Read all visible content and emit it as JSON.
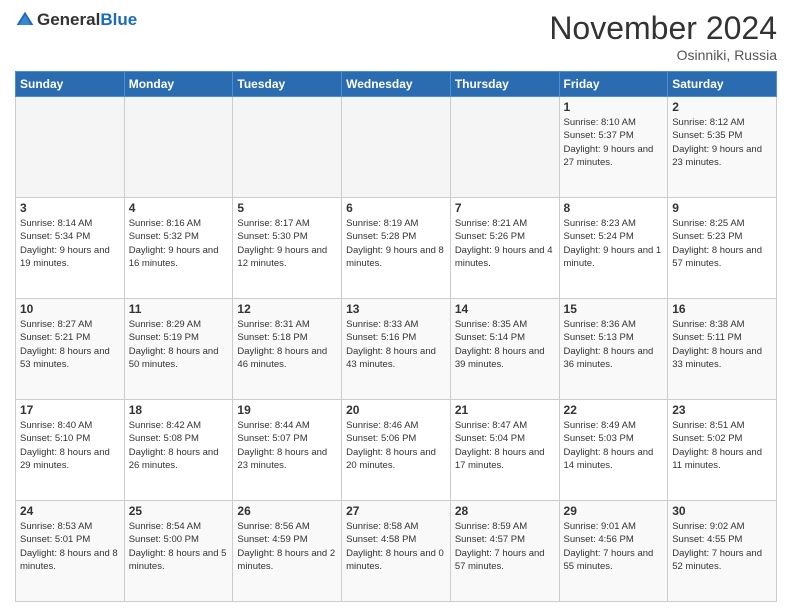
{
  "header": {
    "logo_line1": "General",
    "logo_line2": "Blue",
    "month_title": "November 2024",
    "location": "Osinniki, Russia"
  },
  "weekdays": [
    "Sunday",
    "Monday",
    "Tuesday",
    "Wednesday",
    "Thursday",
    "Friday",
    "Saturday"
  ],
  "weeks": [
    [
      {
        "day": "",
        "info": ""
      },
      {
        "day": "",
        "info": ""
      },
      {
        "day": "",
        "info": ""
      },
      {
        "day": "",
        "info": ""
      },
      {
        "day": "",
        "info": ""
      },
      {
        "day": "1",
        "info": "Sunrise: 8:10 AM\nSunset: 5:37 PM\nDaylight: 9 hours and 27 minutes."
      },
      {
        "day": "2",
        "info": "Sunrise: 8:12 AM\nSunset: 5:35 PM\nDaylight: 9 hours and 23 minutes."
      }
    ],
    [
      {
        "day": "3",
        "info": "Sunrise: 8:14 AM\nSunset: 5:34 PM\nDaylight: 9 hours and 19 minutes."
      },
      {
        "day": "4",
        "info": "Sunrise: 8:16 AM\nSunset: 5:32 PM\nDaylight: 9 hours and 16 minutes."
      },
      {
        "day": "5",
        "info": "Sunrise: 8:17 AM\nSunset: 5:30 PM\nDaylight: 9 hours and 12 minutes."
      },
      {
        "day": "6",
        "info": "Sunrise: 8:19 AM\nSunset: 5:28 PM\nDaylight: 9 hours and 8 minutes."
      },
      {
        "day": "7",
        "info": "Sunrise: 8:21 AM\nSunset: 5:26 PM\nDaylight: 9 hours and 4 minutes."
      },
      {
        "day": "8",
        "info": "Sunrise: 8:23 AM\nSunset: 5:24 PM\nDaylight: 9 hours and 1 minute."
      },
      {
        "day": "9",
        "info": "Sunrise: 8:25 AM\nSunset: 5:23 PM\nDaylight: 8 hours and 57 minutes."
      }
    ],
    [
      {
        "day": "10",
        "info": "Sunrise: 8:27 AM\nSunset: 5:21 PM\nDaylight: 8 hours and 53 minutes."
      },
      {
        "day": "11",
        "info": "Sunrise: 8:29 AM\nSunset: 5:19 PM\nDaylight: 8 hours and 50 minutes."
      },
      {
        "day": "12",
        "info": "Sunrise: 8:31 AM\nSunset: 5:18 PM\nDaylight: 8 hours and 46 minutes."
      },
      {
        "day": "13",
        "info": "Sunrise: 8:33 AM\nSunset: 5:16 PM\nDaylight: 8 hours and 43 minutes."
      },
      {
        "day": "14",
        "info": "Sunrise: 8:35 AM\nSunset: 5:14 PM\nDaylight: 8 hours and 39 minutes."
      },
      {
        "day": "15",
        "info": "Sunrise: 8:36 AM\nSunset: 5:13 PM\nDaylight: 8 hours and 36 minutes."
      },
      {
        "day": "16",
        "info": "Sunrise: 8:38 AM\nSunset: 5:11 PM\nDaylight: 8 hours and 33 minutes."
      }
    ],
    [
      {
        "day": "17",
        "info": "Sunrise: 8:40 AM\nSunset: 5:10 PM\nDaylight: 8 hours and 29 minutes."
      },
      {
        "day": "18",
        "info": "Sunrise: 8:42 AM\nSunset: 5:08 PM\nDaylight: 8 hours and 26 minutes."
      },
      {
        "day": "19",
        "info": "Sunrise: 8:44 AM\nSunset: 5:07 PM\nDaylight: 8 hours and 23 minutes."
      },
      {
        "day": "20",
        "info": "Sunrise: 8:46 AM\nSunset: 5:06 PM\nDaylight: 8 hours and 20 minutes."
      },
      {
        "day": "21",
        "info": "Sunrise: 8:47 AM\nSunset: 5:04 PM\nDaylight: 8 hours and 17 minutes."
      },
      {
        "day": "22",
        "info": "Sunrise: 8:49 AM\nSunset: 5:03 PM\nDaylight: 8 hours and 14 minutes."
      },
      {
        "day": "23",
        "info": "Sunrise: 8:51 AM\nSunset: 5:02 PM\nDaylight: 8 hours and 11 minutes."
      }
    ],
    [
      {
        "day": "24",
        "info": "Sunrise: 8:53 AM\nSunset: 5:01 PM\nDaylight: 8 hours and 8 minutes."
      },
      {
        "day": "25",
        "info": "Sunrise: 8:54 AM\nSunset: 5:00 PM\nDaylight: 8 hours and 5 minutes."
      },
      {
        "day": "26",
        "info": "Sunrise: 8:56 AM\nSunset: 4:59 PM\nDaylight: 8 hours and 2 minutes."
      },
      {
        "day": "27",
        "info": "Sunrise: 8:58 AM\nSunset: 4:58 PM\nDaylight: 8 hours and 0 minutes."
      },
      {
        "day": "28",
        "info": "Sunrise: 8:59 AM\nSunset: 4:57 PM\nDaylight: 7 hours and 57 minutes."
      },
      {
        "day": "29",
        "info": "Sunrise: 9:01 AM\nSunset: 4:56 PM\nDaylight: 7 hours and 55 minutes."
      },
      {
        "day": "30",
        "info": "Sunrise: 9:02 AM\nSunset: 4:55 PM\nDaylight: 7 hours and 52 minutes."
      }
    ]
  ]
}
